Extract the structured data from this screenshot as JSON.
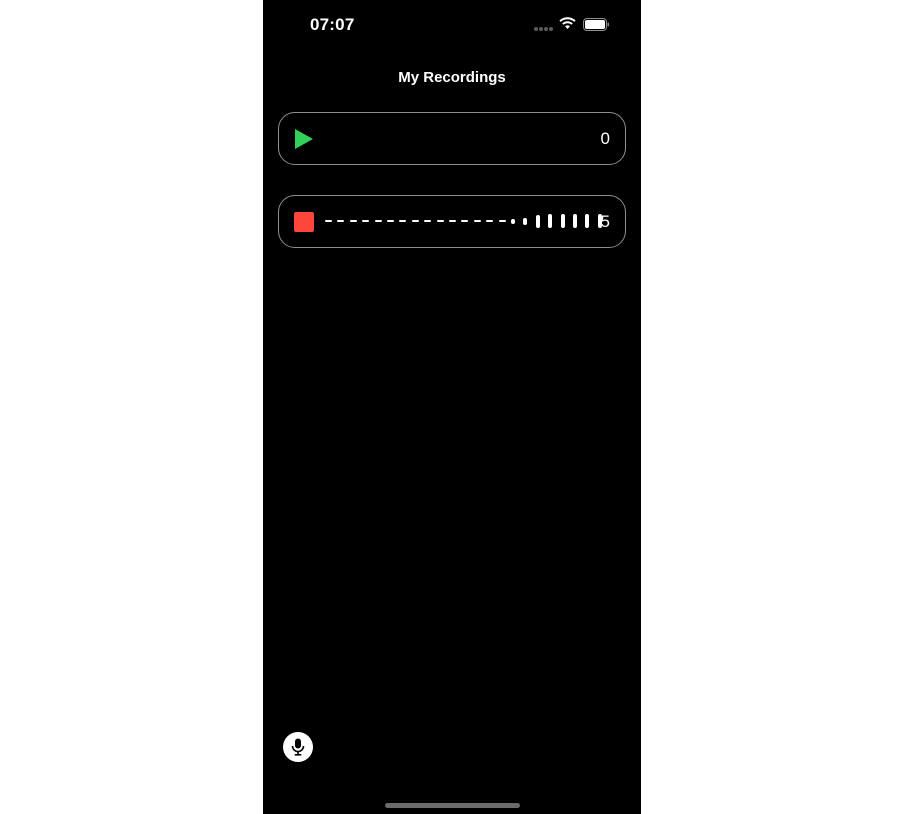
{
  "status_bar": {
    "time": "07:07",
    "icons": [
      "signal-dots-icon",
      "wifi-icon",
      "battery-icon"
    ]
  },
  "nav": {
    "title": "My Recordings"
  },
  "recordings": [
    {
      "control": "play",
      "control_icon": "play-icon",
      "count": "0",
      "accent": "#30d158"
    },
    {
      "control": "stop",
      "control_icon": "stop-icon",
      "count": "5",
      "accent": "#ff453a",
      "waveform": [
        0.2,
        0.2,
        0.2,
        0.2,
        0.2,
        0.2,
        0.2,
        0.2,
        0.2,
        0.2,
        0.2,
        0.2,
        0.2,
        0.2,
        0.2,
        0.35,
        0.5,
        0.9,
        1,
        1,
        1,
        1,
        1
      ]
    }
  ],
  "toolbar": {
    "record_icon": "microphone-icon"
  },
  "colors": {
    "background": "#000000",
    "border": "#8e8e93",
    "text": "#ffffff"
  }
}
